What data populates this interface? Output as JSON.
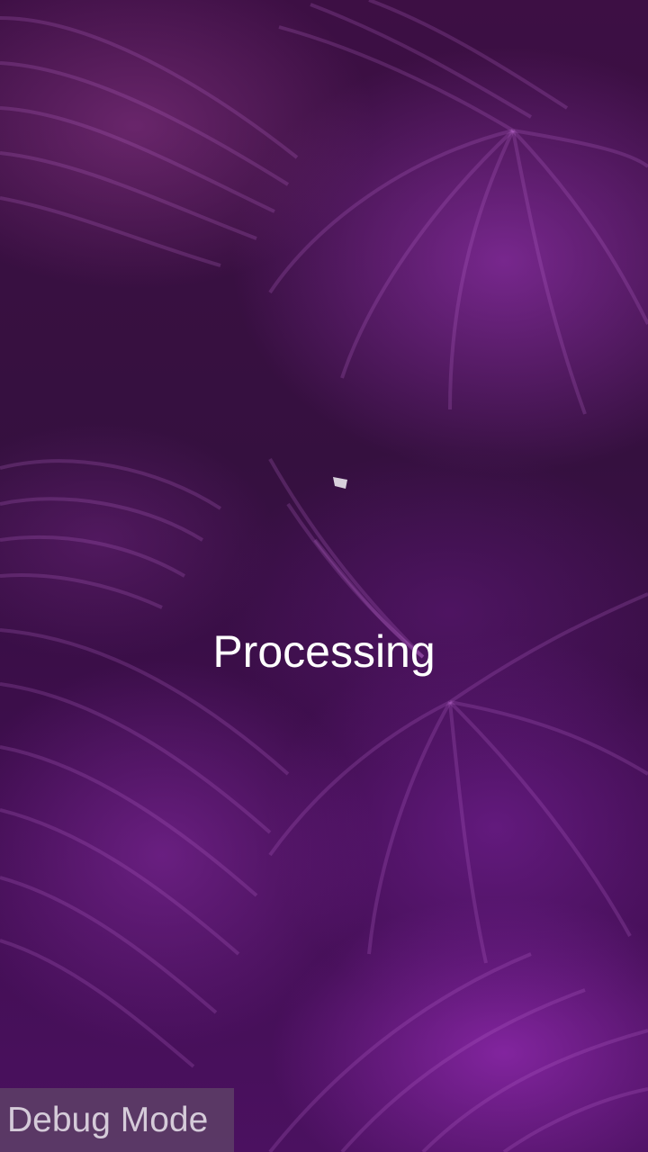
{
  "screen": {
    "status_text": "Processing",
    "debug_label": "Debug Mode"
  },
  "icons": {
    "spinner": "loading-spinner-icon",
    "background": "purple-leaves-background"
  },
  "colors": {
    "status_text": "#ffffff",
    "debug_text": "#d5cbd9",
    "debug_background": "#5c3e66",
    "spinner": "#d8d0dc",
    "background_base": "#3d0f44"
  }
}
